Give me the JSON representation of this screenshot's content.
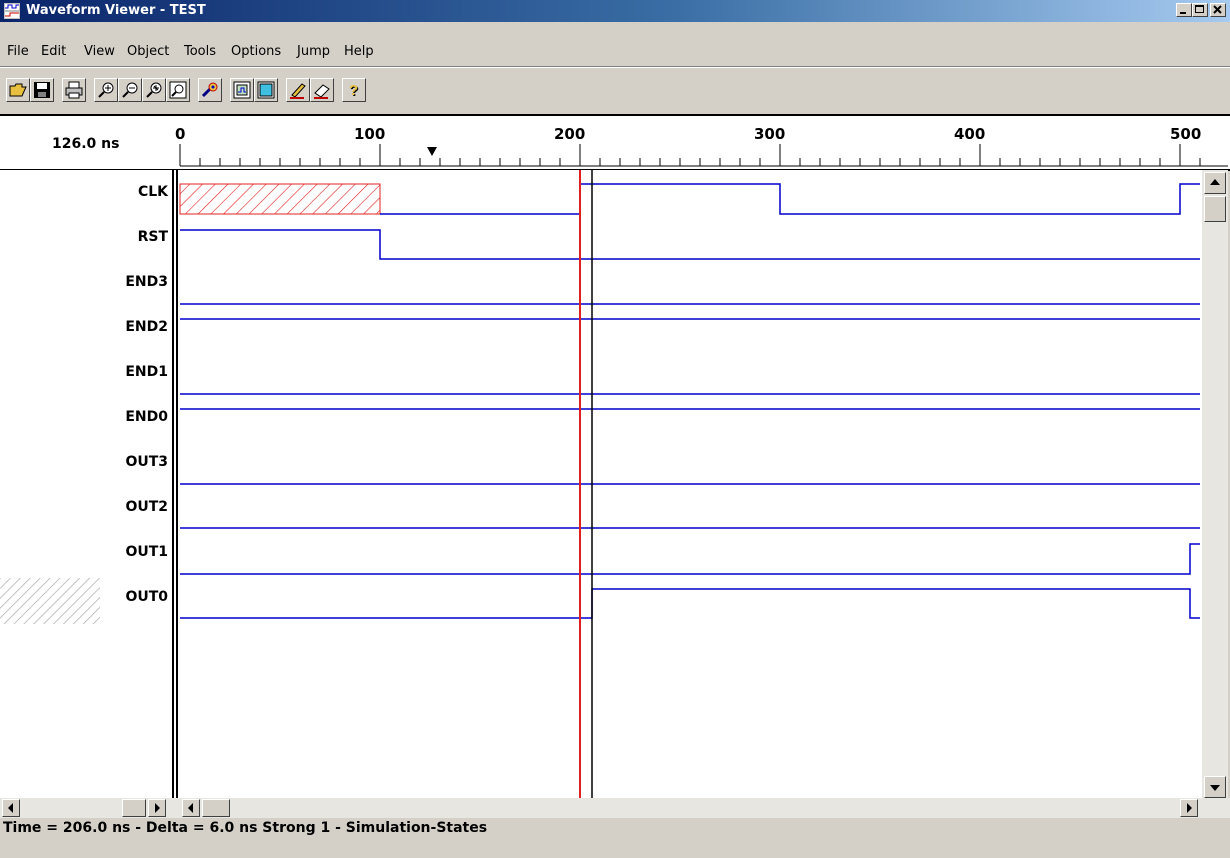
{
  "window": {
    "title": "Waveform Viewer - TEST"
  },
  "menu": [
    {
      "label": "File"
    },
    {
      "label": "Edit"
    },
    {
      "label": "View"
    },
    {
      "label": "Object"
    },
    {
      "label": "Tools"
    },
    {
      "label": "Options"
    },
    {
      "label": "Jump"
    },
    {
      "label": "Help"
    }
  ],
  "toolbar": {
    "buttons": [
      {
        "icon": "open-folder-icon"
      },
      {
        "icon": "save-icon"
      },
      {
        "icon": "print-icon"
      },
      {
        "icon": "zoom-in-icon"
      },
      {
        "icon": "zoom-out-icon"
      },
      {
        "icon": "zoom-area-icon"
      },
      {
        "icon": "zoom-fit-icon"
      },
      {
        "icon": "run-icon"
      },
      {
        "icon": "show-window-icon"
      },
      {
        "icon": "blank-window-icon"
      },
      {
        "icon": "pencil-icon"
      },
      {
        "icon": "eraser-icon"
      },
      {
        "icon": "help-icon"
      }
    ]
  },
  "timeline": {
    "cursor_time": "126.0 ns",
    "ticks": [
      "0",
      "100",
      "200",
      "300",
      "400",
      "500"
    ],
    "range_ns": [
      0,
      510
    ],
    "cursor_marker_ns": 126,
    "red_cursor_ns": 200,
    "black_cursor_ns": 206
  },
  "signals": [
    {
      "name": "CLK"
    },
    {
      "name": "RST"
    },
    {
      "name": "END3"
    },
    {
      "name": "END2"
    },
    {
      "name": "END1"
    },
    {
      "name": "END0"
    },
    {
      "name": "OUT3"
    },
    {
      "name": "OUT2"
    },
    {
      "name": "OUT1"
    },
    {
      "name": "OUT0"
    }
  ],
  "status": {
    "text": "Time = 206.0 ns - Delta = 6.0 ns Strong 1 - Simulation-States"
  },
  "colors": {
    "title_start": "#0a246a",
    "waveform": "#0000cc",
    "red_cursor": "#e02020",
    "black_cursor": "#000000",
    "hatch": "#e02020"
  }
}
